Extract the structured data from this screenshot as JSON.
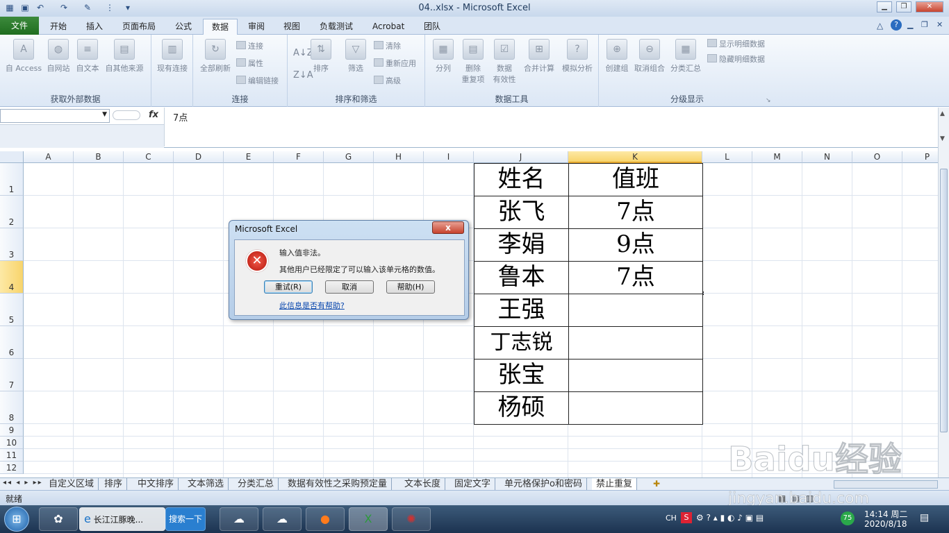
{
  "window": {
    "title": "04..xlsx  -  Microsoft Excel"
  },
  "tabs": [
    "文件",
    "开始",
    "插入",
    "页面布局",
    "公式",
    "数据",
    "审阅",
    "视图",
    "负载测试",
    "Acrobat",
    "团队"
  ],
  "ribbon": {
    "get_external": {
      "label": "获取外部数据",
      "buttons": [
        "自 Access",
        "自网站",
        "自文本",
        "自其他来源"
      ]
    },
    "existing_conn": "现有连接",
    "connections": {
      "label": "连接",
      "refresh_all": "全部刷新",
      "small": [
        "连接",
        "属性",
        "编辑链接"
      ]
    },
    "sort_filter": {
      "label": "排序和筛选",
      "sort": "排序",
      "filter": "筛选",
      "small": [
        "清除",
        "重新应用",
        "高级"
      ]
    },
    "data_tools": {
      "label": "数据工具",
      "buttons": [
        "分列",
        "删除\n重复项",
        "数据\n有效性",
        "合并计算",
        "模拟分析"
      ]
    },
    "outline": {
      "label": "分级显示",
      "buttons": [
        "创建组",
        "取消组合",
        "分类汇总"
      ],
      "small": [
        "显示明细数据",
        "隐藏明细数据"
      ]
    }
  },
  "formula_bar": {
    "name_box": "",
    "fx": "fx",
    "content": "7点"
  },
  "columns": [
    "A",
    "B",
    "C",
    "D",
    "E",
    "F",
    "G",
    "H",
    "I",
    "J",
    "K",
    "L",
    "M",
    "N",
    "O",
    "P"
  ],
  "rows": [
    "1",
    "2",
    "3",
    "4",
    "5",
    "6",
    "7",
    "8",
    "9",
    "10",
    "11",
    "12"
  ],
  "table": [
    [
      "姓名",
      "值班"
    ],
    [
      "张飞",
      "7点"
    ],
    [
      "李娟",
      "9点"
    ],
    [
      "鲁本",
      "7点"
    ],
    [
      "王强",
      ""
    ],
    [
      "丁志锐",
      ""
    ],
    [
      "张宝",
      ""
    ],
    [
      "杨硕",
      ""
    ]
  ],
  "sheet_tabs": [
    "自定义区域",
    "排序",
    "中文排序",
    "文本筛选",
    "分类汇总",
    "数据有效性之采购预定量",
    "文本长度",
    "固定文字",
    "单元格保护o和密码",
    "禁止重复"
  ],
  "status": "就绪",
  "dialog": {
    "title": "Microsoft Excel",
    "line1": "输入值非法。",
    "line2": "其他用户已经限定了可以输入该单元格的数值。",
    "retry": "重试(R)",
    "cancel": "取消",
    "help": "帮助(H)",
    "link": "此信息是否有帮助?",
    "close": "x"
  },
  "taskbar": {
    "ie_label": "长江江豚晚...",
    "search_label": "搜索一下",
    "ime": "CH",
    "badge": "75",
    "time": "14:14 周二",
    "date": "2020/8/18"
  },
  "watermark": {
    "text1": "Baidu经验",
    "text2": "jingyan.baidu.com"
  }
}
